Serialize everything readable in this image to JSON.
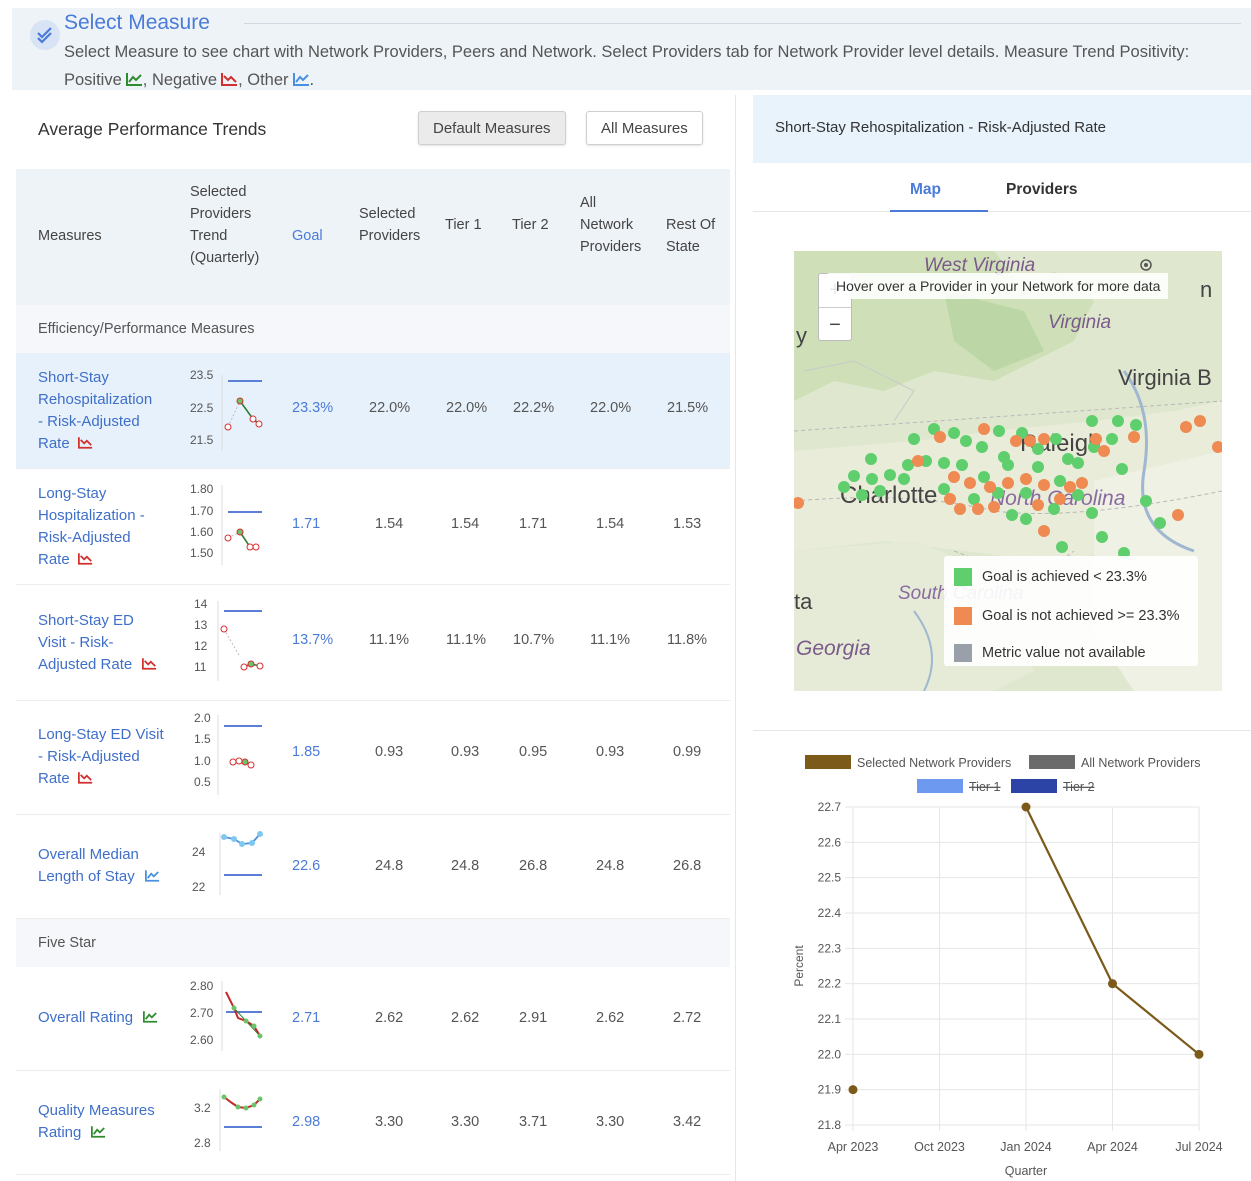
{
  "header": {
    "title": "Select Measure",
    "description_parts": {
      "before": "Select Measure to see chart with Network Providers, Peers and Network. Select Providers tab for Network Provider level details. Measure Trend Positivity:",
      "positive": "Positive",
      "negative": "Negative",
      "other": "Other",
      "end": "."
    }
  },
  "colors": {
    "accent": "#4a7bd8",
    "positive_icon": "#2e8b2e",
    "negative_icon": "#d32f2f",
    "other_icon": "#4a90e2",
    "goal_achieved": "#5fcf6e",
    "goal_not_achieved": "#ee8a52",
    "not_available": "#9aa0aa",
    "series_selected_network": "#7b5a1a",
    "series_all_network": "#6b6b6b",
    "series_tier1": "#6e99f0",
    "series_tier2": "#2b44a6"
  },
  "table": {
    "title": "Average Performance Trends",
    "buttons": [
      "Default Measures",
      "All Measures"
    ],
    "columns": {
      "measures": "Measures",
      "trend": [
        "Selected",
        "Providers",
        "Trend",
        "(Quarterly)"
      ],
      "goal": "Goal",
      "selected": [
        "Selected",
        "Providers"
      ],
      "tier1": "Tier 1",
      "tier2": "Tier 2",
      "all": [
        "All",
        "Network",
        "Providers"
      ],
      "rest": [
        "Rest Of",
        "State"
      ]
    },
    "sections": [
      "Efficiency/Performance Measures",
      "Five Star"
    ],
    "rows": [
      {
        "name_lines": [
          "Short-Stay",
          "Rehospitalization",
          "- Risk-Adjusted",
          "Rate"
        ],
        "trend_icon": "negative-trend-icon",
        "axis": [
          "23.5",
          "22.5",
          "21.5"
        ],
        "goal": "23.3%",
        "selected": "22.0%",
        "tier1": "22.0%",
        "tier2": "22.2%",
        "all": "22.0%",
        "rest": "21.5%"
      },
      {
        "name_lines": [
          "Long-Stay",
          "Hospitalization -",
          "Risk-Adjusted",
          "Rate"
        ],
        "trend_icon": "negative-trend-icon",
        "axis": [
          "1.80",
          "1.70",
          "1.60",
          "1.50"
        ],
        "goal": "1.71",
        "selected": "1.54",
        "tier1": "1.54",
        "tier2": "1.71",
        "all": "1.54",
        "rest": "1.53"
      },
      {
        "name_lines": [
          "Short-Stay ED",
          "Visit - Risk-",
          "Adjusted Rate"
        ],
        "trend_icon": "negative-trend-icon",
        "axis": [
          "14",
          "13",
          "12",
          "11"
        ],
        "goal": "13.7%",
        "selected": "11.1%",
        "tier1": "11.1%",
        "tier2": "10.7%",
        "all": "11.1%",
        "rest": "11.8%"
      },
      {
        "name_lines": [
          "Long-Stay ED Visit",
          "- Risk-Adjusted",
          "Rate"
        ],
        "trend_icon": "negative-trend-icon",
        "axis": [
          "2.0",
          "1.5",
          "1.0",
          "0.5"
        ],
        "goal": "1.85",
        "selected": "0.93",
        "tier1": "0.93",
        "tier2": "0.95",
        "all": "0.93",
        "rest": "0.99"
      },
      {
        "name_lines": [
          "Overall Median",
          "Length of Stay"
        ],
        "trend_icon": "other-trend-icon",
        "axis": [
          "24",
          "22"
        ],
        "goal": "22.6",
        "selected": "24.8",
        "tier1": "24.8",
        "tier2": "26.8",
        "all": "24.8",
        "rest": "26.8"
      },
      {
        "name_lines": [
          "Overall Rating"
        ],
        "trend_icon": "positive-trend-icon",
        "axis": [
          "2.80",
          "2.70",
          "2.60"
        ],
        "goal": "2.71",
        "selected": "2.62",
        "tier1": "2.62",
        "tier2": "2.91",
        "all": "2.62",
        "rest": "2.72"
      },
      {
        "name_lines": [
          "Quality Measures",
          "Rating"
        ],
        "trend_icon": "positive-trend-icon",
        "axis": [
          "3.2",
          "2.8"
        ],
        "goal": "2.98",
        "selected": "3.30",
        "tier1": "3.30",
        "tier2": "3.71",
        "all": "3.30",
        "rest": "3.42"
      }
    ]
  },
  "detail": {
    "title": "Short-Stay Rehospitalization - Risk-Adjusted Rate",
    "tabs": [
      "Map",
      "Providers"
    ],
    "active_tab": "Map",
    "map": {
      "hover_text": "Hover over a Provider in your Network for more data",
      "zoom_in": "+",
      "zoom_out": "−",
      "place_labels": [
        "West Virginia",
        "Virginia",
        "Virginia B",
        "Raleigh",
        "Charlotte",
        "North Carolina",
        "South Carolina",
        "Georgia",
        "ta",
        "y",
        "n"
      ],
      "legend": [
        {
          "label": "Goal is achieved < 23.3%",
          "color": "#5fcf6e"
        },
        {
          "label": "Goal is not achieved >= 23.3%",
          "color": "#ee8a52"
        },
        {
          "label": "Metric value not available",
          "color": "#9aa0aa"
        }
      ]
    }
  },
  "chart_data": {
    "type": "line",
    "xlabel": "Quarter",
    "ylabel": "Percent",
    "ylim": [
      21.8,
      22.7
    ],
    "yticks": [
      "22.7",
      "22.6",
      "22.5",
      "22.4",
      "22.3",
      "22.2",
      "22.1",
      "22.0",
      "21.9",
      "21.8"
    ],
    "xticks": [
      "Apr 2023",
      "Oct 2023",
      "Jan 2024",
      "Apr 2024",
      "Jul 2024"
    ],
    "legend": [
      {
        "name": "Selected Network Providers",
        "hidden": false
      },
      {
        "name": "All Network Providers",
        "hidden": false
      },
      {
        "name": "Tier 1",
        "hidden": true
      },
      {
        "name": "Tier 2",
        "hidden": true
      }
    ],
    "series": [
      {
        "name": "Selected Network Providers",
        "x": [
          "Apr 2023",
          "Jan 2024",
          "Apr 2024",
          "Jul 2024"
        ],
        "values": [
          21.9,
          22.7,
          22.2,
          22.0
        ],
        "connected_from": "Jan 2024"
      }
    ],
    "grid": true
  }
}
